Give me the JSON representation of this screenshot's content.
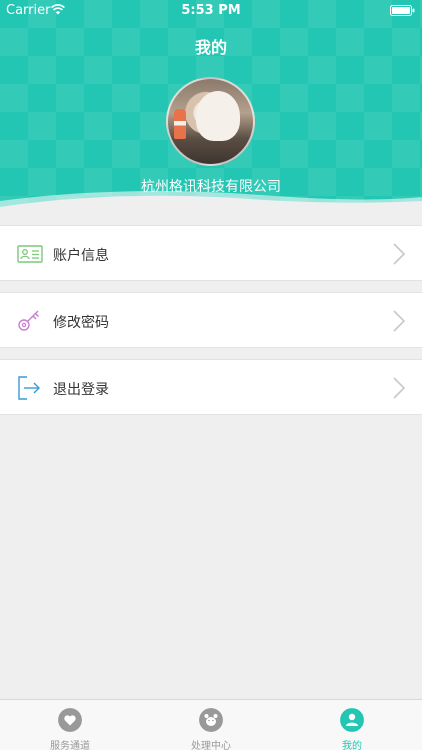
{
  "status_bar": {
    "carrier": "Carrier",
    "time": "5:53 PM"
  },
  "header": {
    "title": "我的",
    "company": "杭州格讯科技有限公司"
  },
  "menu": [
    {
      "label": "账户信息",
      "icon": "id-card-icon",
      "color": "#7dc87a"
    },
    {
      "label": "修改密码",
      "icon": "key-icon",
      "color": "#c77ed0"
    },
    {
      "label": "退出登录",
      "icon": "logout-icon",
      "color": "#3a9ad9"
    }
  ],
  "tabbar": {
    "tabs": [
      {
        "label": "服务通道",
        "icon": "heart-icon",
        "active": false
      },
      {
        "label": "处理中心",
        "icon": "bear-icon",
        "active": false
      },
      {
        "label": "我的",
        "icon": "person-icon",
        "active": true
      }
    ],
    "active_color": "#23c6b2",
    "inactive_color": "#999999"
  },
  "colors": {
    "accent": "#23c6b2",
    "background": "#efefef"
  }
}
